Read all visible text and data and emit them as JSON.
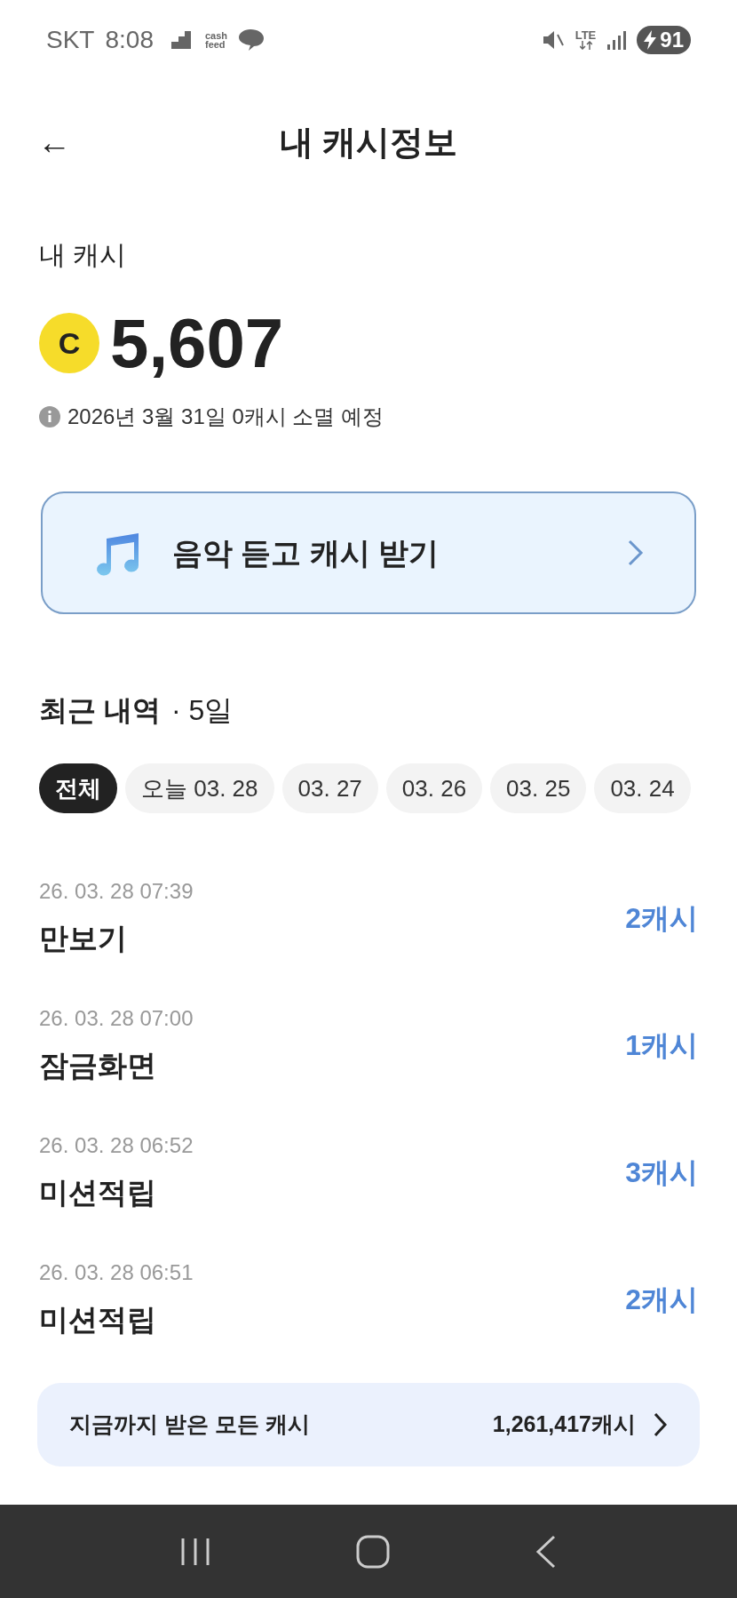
{
  "status_bar": {
    "carrier": "SKT",
    "time": "8:08",
    "app_badge": [
      "cash",
      "feed"
    ],
    "network": "LTE",
    "battery": "91"
  },
  "header": {
    "back": "←",
    "title": "내 캐시정보"
  },
  "balance": {
    "label": "내 캐시",
    "coin": "C",
    "amount": "5,607",
    "notice": "2026년 3월 31일 0캐시 소멸 예정"
  },
  "promo": {
    "label": "음악 듣고 캐시 받기"
  },
  "history": {
    "title": "최근 내역",
    "period": "· 5일",
    "filters": [
      {
        "label": "전체",
        "selected": true
      },
      {
        "label": "오늘 03. 28",
        "selected": false
      },
      {
        "label": "03. 27",
        "selected": false
      },
      {
        "label": "03. 26",
        "selected": false
      },
      {
        "label": "03. 25",
        "selected": false
      },
      {
        "label": "03. 24",
        "selected": false
      }
    ],
    "items": [
      {
        "datetime": "26. 03. 28 07:39",
        "title": "만보기",
        "amount": "2캐시"
      },
      {
        "datetime": "26. 03. 28 07:00",
        "title": "잠금화면",
        "amount": "1캐시"
      },
      {
        "datetime": "26. 03. 28 06:52",
        "title": "미션적립",
        "amount": "3캐시"
      },
      {
        "datetime": "26. 03. 28 06:51",
        "title": "미션적립",
        "amount": "2캐시"
      }
    ]
  },
  "total": {
    "label": "지금까지 받은 모든 캐시",
    "amount": "1,261,417캐시"
  }
}
